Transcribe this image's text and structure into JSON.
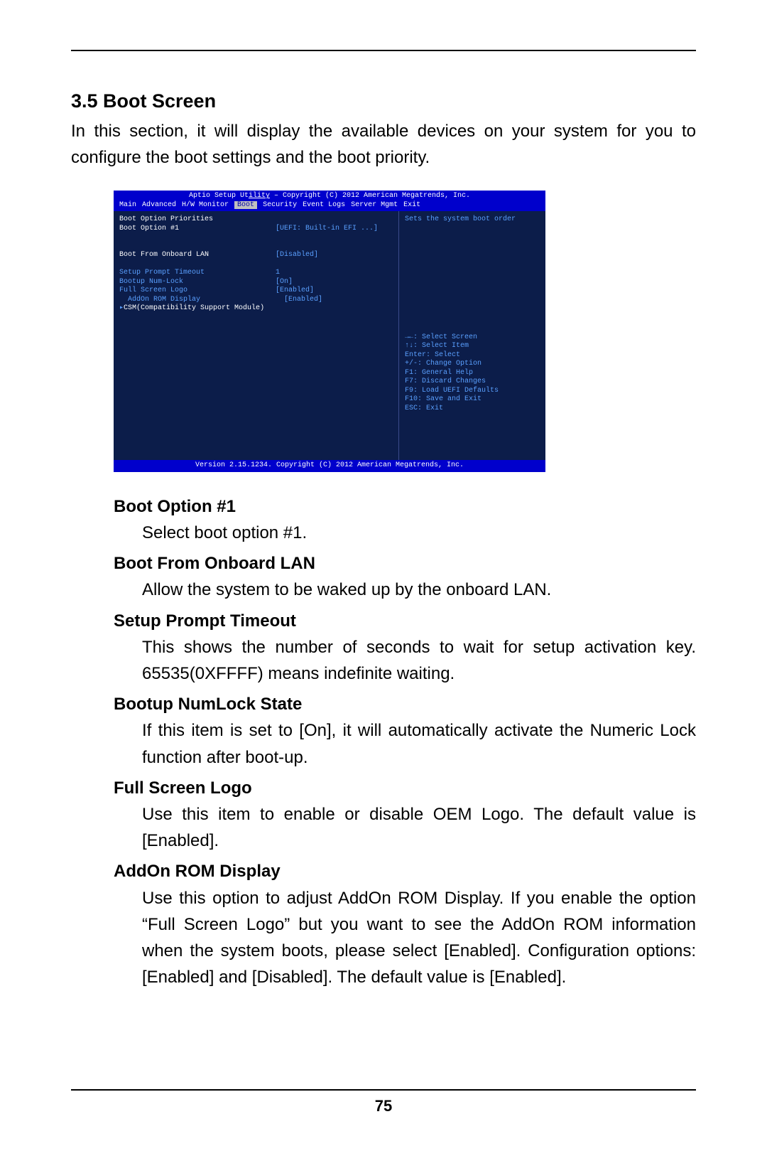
{
  "section": {
    "heading": "3.5  Boot Screen",
    "intro": "In this section, it will display the available devices on your system for you to configure the boot settings and the boot priority."
  },
  "bios": {
    "title_left": "Aptio Setup Ut",
    "title_underline": "ility",
    "title_right": " – Copyright (C) 2012 American Megatrends, Inc.",
    "tabs": [
      "Main",
      "Advanced",
      "H/W Monitor",
      "Boot",
      "Security",
      "Event Logs",
      "Server Mgmt",
      "Exit"
    ],
    "selected_tab_index": 3,
    "left": {
      "group_title": "Boot Option Priorities",
      "rows": [
        {
          "label": "Boot Option #1",
          "value": "[UEFI: Built-in EFI ...]",
          "cls": "white"
        }
      ],
      "spacer1": "",
      "rows2": [
        {
          "label": "Boot From Onboard LAN",
          "value": "[Disabled]",
          "cls": "white"
        }
      ],
      "spacer2": "",
      "cfg_rows": [
        {
          "label": "Setup Prompt Timeout",
          "value": "1"
        },
        {
          "label": "Bootup Num-Lock",
          "value": "[On]"
        },
        {
          "label": "Full Screen Logo",
          "value": "[Enabled]"
        },
        {
          "label": "AddOn ROM Display",
          "value": "[Enabled]",
          "sub": true
        }
      ],
      "csm_line": "CSM(Compatibility Support Module)"
    },
    "right": {
      "hint": "Sets the system boot order",
      "help": [
        "→←: Select Screen",
        "↑↓: Select Item",
        "Enter: Select",
        "+/-: Change Option",
        "F1: General Help",
        "F7: Discard Changes",
        "F9: Load UEFI Defaults",
        "F10: Save and Exit",
        "ESC: Exit"
      ]
    },
    "footer": "Version 2.15.1234. Copyright (C) 2012 American Megatrends, Inc."
  },
  "definitions": [
    {
      "term": "Boot Option #1",
      "desc": "Select boot option #1."
    },
    {
      "term": "Boot From Onboard LAN",
      "desc": "Allow the system to be waked up by the onboard LAN."
    },
    {
      "term": "Setup Prompt Timeout",
      "desc": "This shows the number of seconds to wait for setup activation key. 65535(0XFFFF) means indefinite waiting."
    },
    {
      "term": "Bootup NumLock State",
      "desc": "If this item is set to [On], it will automatically activate the Numeric Lock function after boot-up."
    },
    {
      "term": "Full Screen Logo",
      "desc": "Use this item to enable or disable OEM Logo. The default value is [Enabled]."
    },
    {
      "term": "AddOn ROM Display",
      "desc": "Use this option to adjust AddOn ROM Display. If you enable the option “Full Screen Logo” but you want to see the AddOn ROM information when the system boots, please select [Enabled]. Configuration options: [Enabled] and [Disabled]. The default value is [Enabled]."
    }
  ],
  "page_number": "75"
}
